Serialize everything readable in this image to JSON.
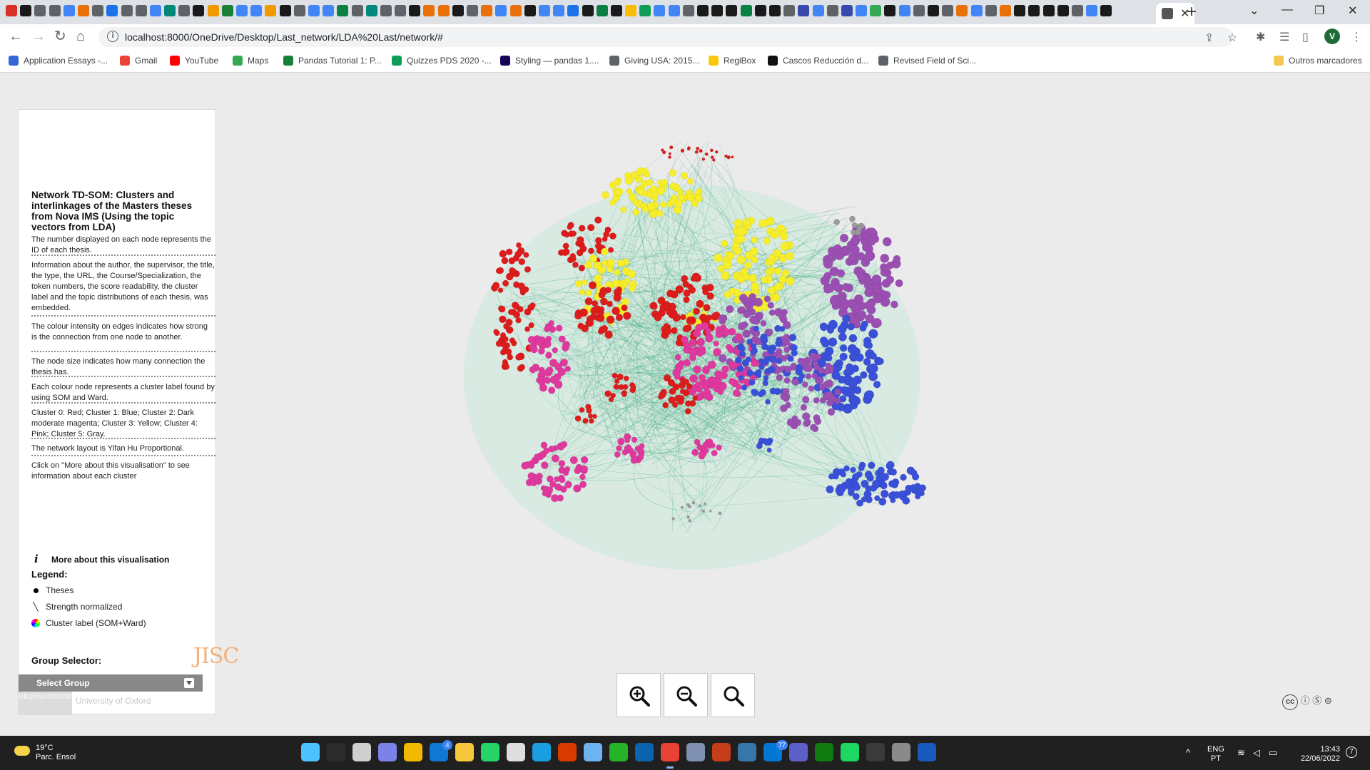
{
  "browser": {
    "address_url": "localhost:8000/OneDrive/Desktop/Last_network/LDA%20Last/network/#",
    "profile_initial": "V",
    "tab_favicon_colors": [
      "#d93025",
      "#1a1a1a",
      "#5f6368",
      "#5f6368",
      "#4285f4",
      "#e8710a",
      "#5f6368",
      "#1a73e8",
      "#5f6368",
      "#5f6368",
      "#4285f4",
      "#00897b",
      "#5f6368",
      "#1a1a1a",
      "#f29900",
      "#188038",
      "#4285f4",
      "#4285f4",
      "#f29900",
      "#1a1a1a",
      "#5f6368",
      "#4285f4",
      "#4285f4",
      "#0b8043",
      "#5f6368",
      "#00897b",
      "#5f6368",
      "#5f6368",
      "#1a1a1a",
      "#e8710a",
      "#e8710a",
      "#1a1a1a",
      "#5f6368",
      "#e8710a",
      "#4285f4",
      "#e8710a",
      "#1a1a1a",
      "#4285f4",
      "#4285f4",
      "#1a73e8",
      "#1a1a1a",
      "#0b8043",
      "#1a1a1a",
      "#fbbc04",
      "#0f9d58",
      "#4285f4",
      "#4285f4",
      "#5f6368",
      "#1a1a1a",
      "#1a1a1a",
      "#1a1a1a",
      "#0b8043",
      "#1a1a1a",
      "#1a1a1a",
      "#5f6368",
      "#3949ab",
      "#4285f4",
      "#5f6368",
      "#3949ab",
      "#4285f4",
      "#34a853",
      "#1a1a1a",
      "#4285f4",
      "#5f6368",
      "#1a1a1a",
      "#5f6368",
      "#e8710a",
      "#4285f4",
      "#5f6368",
      "#e8710a",
      "#1a1a1a",
      "#1a1a1a",
      "#1a1a1a",
      "#1a1a1a",
      "#5f6368",
      "#4285f4",
      "#1a1a1a"
    ],
    "bookmarks": [
      {
        "label": "Application Essays -...",
        "color": "#3367d6"
      },
      {
        "label": "Gmail",
        "color": "#ea4335"
      },
      {
        "label": "YouTube",
        "color": "#ff0000"
      },
      {
        "label": "Maps",
        "color": "#34a853"
      },
      {
        "label": "Pandas Tutorial 1: P...",
        "color": "#188038"
      },
      {
        "label": "Quizzes PDS 2020 -...",
        "color": "#0f9d58"
      },
      {
        "label": "Styling — pandas 1....",
        "color": "#150458"
      },
      {
        "label": "Giving USA: 2015...",
        "color": "#5f6368"
      },
      {
        "label": "RegiBox",
        "color": "#f9c80e"
      },
      {
        "label": "Cascos Reducción d...",
        "color": "#111111"
      },
      {
        "label": "Revised Field of Sci...",
        "color": "#5f6368"
      }
    ],
    "other_bookmarks": "Outros marcadores"
  },
  "panel": {
    "title": "Network TD-SOM: Clusters and interlinkages of the Masters theses from Nova IMS (Using the topic vectors from LDA)",
    "info": [
      "The number displayed on each node represents the ID of each thesis.",
      "Information about the author, the supervisor, the title, the type, the URL, the Course/Specialization, the token numbers, the score readability, the cluster label and the topic distributions of each thesis, was embedded.",
      "The colour intensity on edges indicates how strong is the connection from one node to another.",
      "The node size indicates how many connection the thesis has.",
      "Each colour node represents a cluster label found by using SOM and Ward.",
      "Cluster 0: Red; Cluster 1: Blue; Cluster 2: Dark moderate magenta; Cluster 3: Yellow; Cluster 4: Pink; Cluster 5: Gray.",
      "The network layout is Yifan Hu Proportional.",
      "Click on \"More about this visualisation\" to see information about each cluster"
    ],
    "more_link": "More about this visualisation",
    "legend_title": "Legend:",
    "legend": [
      "Theses",
      "Strength normalized",
      "Cluster label (SOM+Ward)"
    ],
    "group_selector_label": "Group Selector:",
    "group_select_value": "Select Group",
    "logo_oxford_text": "University of Oxford",
    "logo_oxford_pattern": "oiioiioiioiioiioiioiioiioiioiioiioii",
    "logo_jisc": "JISC"
  },
  "network": {
    "cluster_colors": {
      "cluster_0": "#dd1c1c",
      "cluster_1": "#3a50d8",
      "cluster_2": "#9b4fb3",
      "cluster_3": "#f6ee2a",
      "cluster_4": "#e0399e",
      "cluster_5": "#9a9a9a"
    },
    "edge_color": "#3aa87a"
  },
  "zoom": {
    "in_icon": "zoom-in-icon",
    "out_icon": "zoom-out-icon",
    "reset_icon": "zoom-reset-icon"
  },
  "taskbar": {
    "weather_temp": "19°C",
    "weather_desc": "Parc. Ensol",
    "apps": [
      {
        "name": "windows-start",
        "color": "#4cc2ff"
      },
      {
        "name": "search",
        "color": "#2b2b2b"
      },
      {
        "name": "task-view",
        "color": "#cfcfcf"
      },
      {
        "name": "teams-chat",
        "color": "#7b83eb"
      },
      {
        "name": "store",
        "color": "#f3b800"
      },
      {
        "name": "mail",
        "color": "#0f78d4",
        "badge": "4"
      },
      {
        "name": "file-explorer",
        "color": "#f8c83c"
      },
      {
        "name": "whatsapp",
        "color": "#25d366"
      },
      {
        "name": "power-automate",
        "color": "#dedede"
      },
      {
        "name": "edge",
        "color": "#1b9de2"
      },
      {
        "name": "office",
        "color": "#d83b01"
      },
      {
        "name": "notepad",
        "color": "#6db3f2"
      },
      {
        "name": "refresh-app",
        "color": "#27b327"
      },
      {
        "name": "outlook",
        "color": "#0a64ad"
      },
      {
        "name": "chrome",
        "color": "#e94235",
        "active": true
      },
      {
        "name": "r-lang",
        "color": "#8090b0"
      },
      {
        "name": "powerpoint",
        "color": "#c43e1c"
      },
      {
        "name": "python",
        "color": "#3776ab"
      },
      {
        "name": "mail-2",
        "color": "#0078d4",
        "badge": "77"
      },
      {
        "name": "teams",
        "color": "#5b5fc7"
      },
      {
        "name": "xbox",
        "color": "#107c10"
      },
      {
        "name": "spotify",
        "color": "#1ed760"
      },
      {
        "name": "terminal",
        "color": "#3a3a3a"
      },
      {
        "name": "gephi",
        "color": "#8a8a8a"
      },
      {
        "name": "word",
        "color": "#185abd"
      }
    ],
    "lang_line1": "ENG",
    "lang_line2": "PT",
    "time": "13:43",
    "date": "22/06/2022",
    "notification_count": "7"
  }
}
